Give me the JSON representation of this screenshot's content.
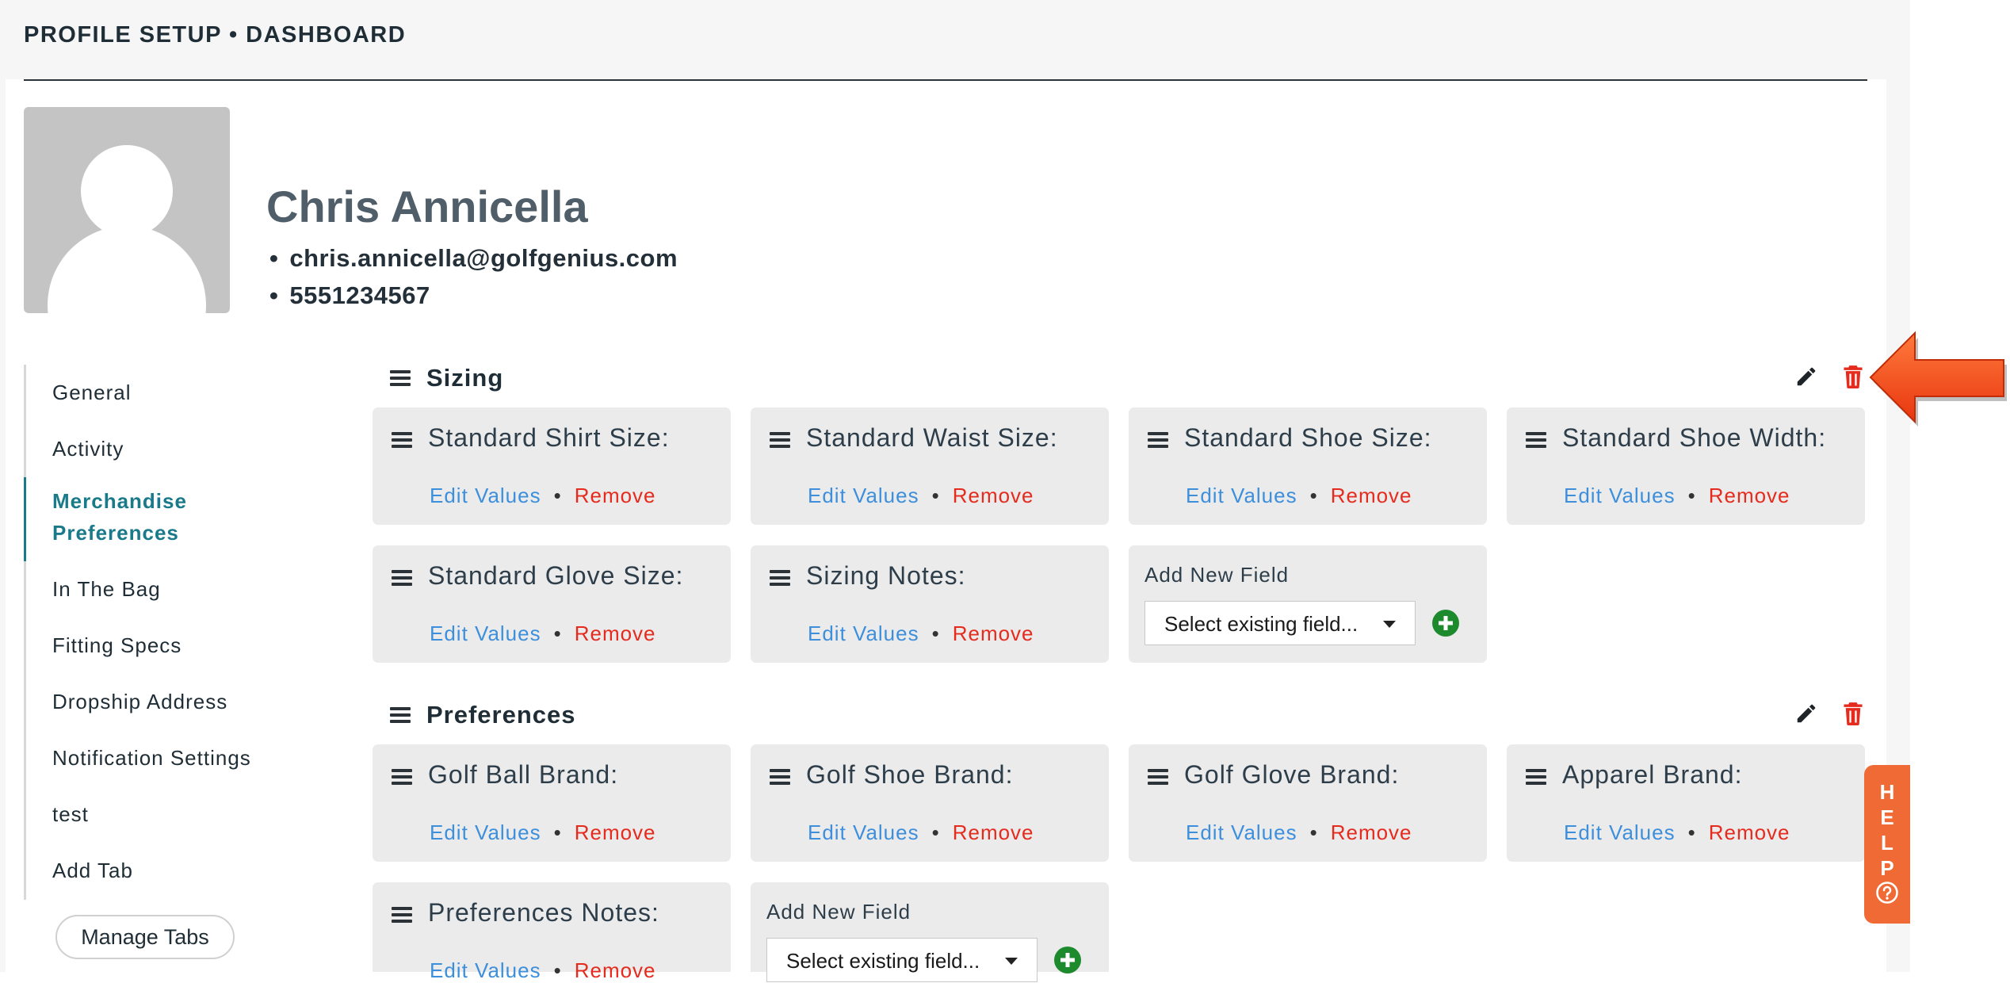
{
  "header": {
    "title": "PROFILE SETUP • DASHBOARD"
  },
  "profile": {
    "name": "Chris Annicella",
    "email": "chris.annicella@golfgenius.com",
    "phone": "5551234567"
  },
  "nav": {
    "items": [
      {
        "label": "General"
      },
      {
        "label": "Activity"
      },
      {
        "label": "Merchandise Preferences",
        "active": true
      },
      {
        "label": "In The Bag"
      },
      {
        "label": "Fitting Specs"
      },
      {
        "label": "Dropship Address"
      },
      {
        "label": "Notification Settings"
      },
      {
        "label": "test"
      },
      {
        "label": "Add Tab"
      }
    ],
    "manage_tabs_label": "Manage Tabs"
  },
  "links": {
    "edit": "Edit Values",
    "remove": "Remove",
    "separator": "•"
  },
  "sections": [
    {
      "title": "Sizing",
      "fields": [
        "Standard Shirt Size:",
        "Standard Waist Size:",
        "Standard Shoe Size:",
        "Standard Shoe Width:",
        "Standard Glove Size:",
        "Sizing Notes:"
      ],
      "add_new_label": "Add New Field",
      "select_placeholder": "Select existing field..."
    },
    {
      "title": "Preferences",
      "fields": [
        "Golf Ball Brand:",
        "Golf Shoe Brand:",
        "Golf Glove Brand:",
        "Apparel Brand:",
        "Preferences Notes:"
      ],
      "add_new_label": "Add New Field",
      "select_placeholder": "Select existing field..."
    }
  ],
  "help": {
    "letters": [
      "H",
      "E",
      "L",
      "P"
    ]
  },
  "colors": {
    "accent": "#1a7a8a",
    "link": "#3d8fdc",
    "danger": "#e52b1d",
    "add": "#1e8a2e",
    "help": "#f06a35",
    "arrow": "#f04a1e"
  }
}
